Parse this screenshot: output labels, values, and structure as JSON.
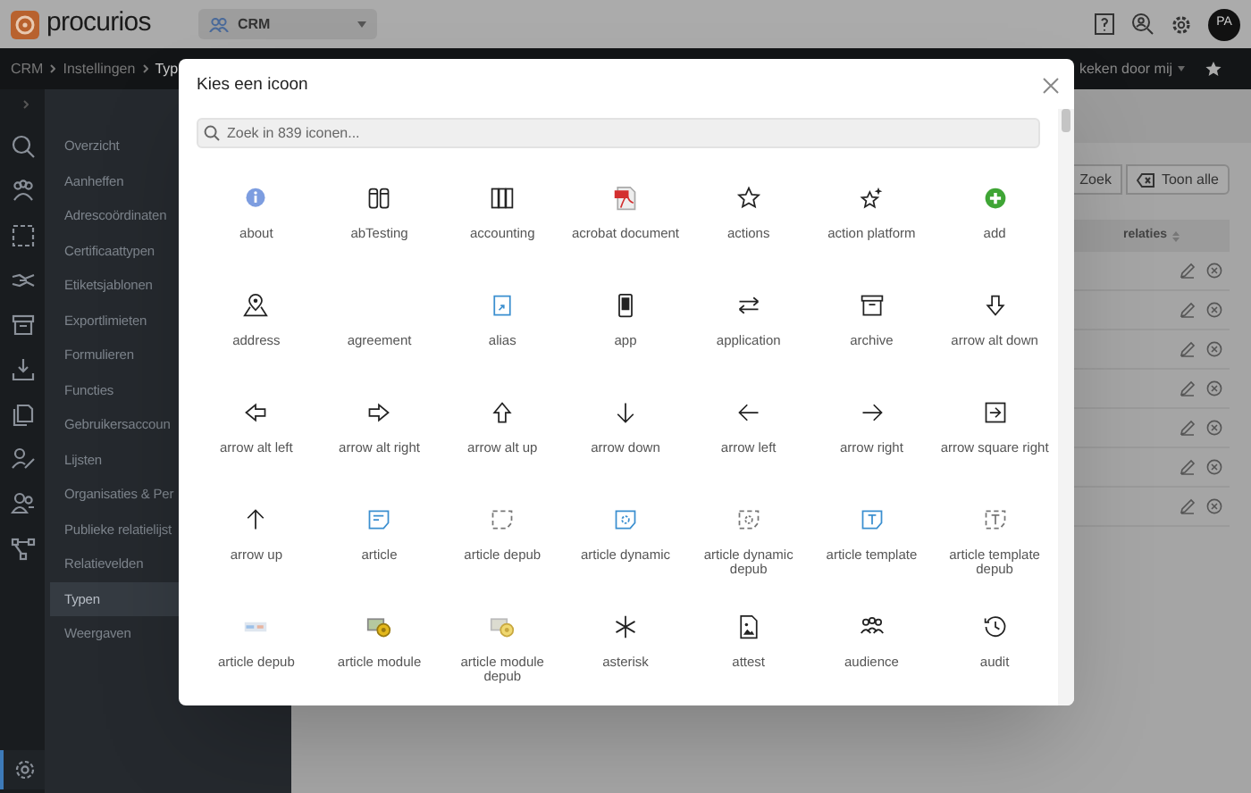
{
  "top_bar": {
    "logo": "procurios",
    "app_switcher": "CRM",
    "avatar": "PA"
  },
  "breadcrumb": {
    "items": [
      "CRM",
      "Instellingen",
      "Typ"
    ],
    "recent": "keken door mij"
  },
  "rail": [
    {
      "selected": false
    },
    {
      "selected": false
    },
    {
      "selected": false
    },
    {
      "selected": false
    },
    {
      "selected": false
    },
    {
      "selected": false
    },
    {
      "selected": false
    },
    {
      "selected": false
    },
    {
      "selected": false
    },
    {
      "selected": false
    },
    {
      "selected": true
    }
  ],
  "sidebar": {
    "items": [
      {
        "label": "Overzicht",
        "selected": false
      },
      {
        "label": "Aanheffen",
        "selected": false
      },
      {
        "label": "Adrescoördinaten",
        "selected": false
      },
      {
        "label": "Certificaattypen",
        "selected": false
      },
      {
        "label": "Etiketsjablonen",
        "selected": false
      },
      {
        "label": "Exportlimieten",
        "selected": false
      },
      {
        "label": "Formulieren",
        "selected": false
      },
      {
        "label": "Functies",
        "selected": false
      },
      {
        "label": "Gebruikersaccoun",
        "selected": false
      },
      {
        "label": "Lijsten",
        "selected": false
      },
      {
        "label": "Organisaties & Per",
        "selected": false
      },
      {
        "label": "Publieke relatielijst",
        "selected": false
      },
      {
        "label": "Relatievelden",
        "selected": false
      },
      {
        "label": "Typen",
        "selected": true
      },
      {
        "label": "Weergaven",
        "selected": false
      }
    ]
  },
  "background_panel": {
    "buttons": [
      "Zoek",
      "Toon alle"
    ],
    "column_header": "relaties"
  },
  "dialog": {
    "title": "Kies een icoon",
    "search": {
      "placeholder": "Zoek in 839 iconen..."
    },
    "icons": [
      "about",
      "abTesting",
      "accounting",
      "acrobat document",
      "actions",
      "action platform",
      "add",
      "address",
      "agreement",
      "alias",
      "app",
      "application",
      "archive",
      "arrow alt down",
      "arrow alt left",
      "arrow alt right",
      "arrow alt up",
      "arrow down",
      "arrow left",
      "arrow right",
      "arrow square right",
      "arrow up",
      "article",
      "article depub",
      "article dynamic",
      "article dynamic depub",
      "article template",
      "article template depub",
      "article depub",
      "article module",
      "article module depub",
      "asterisk",
      "attest",
      "audience",
      "audit"
    ]
  }
}
